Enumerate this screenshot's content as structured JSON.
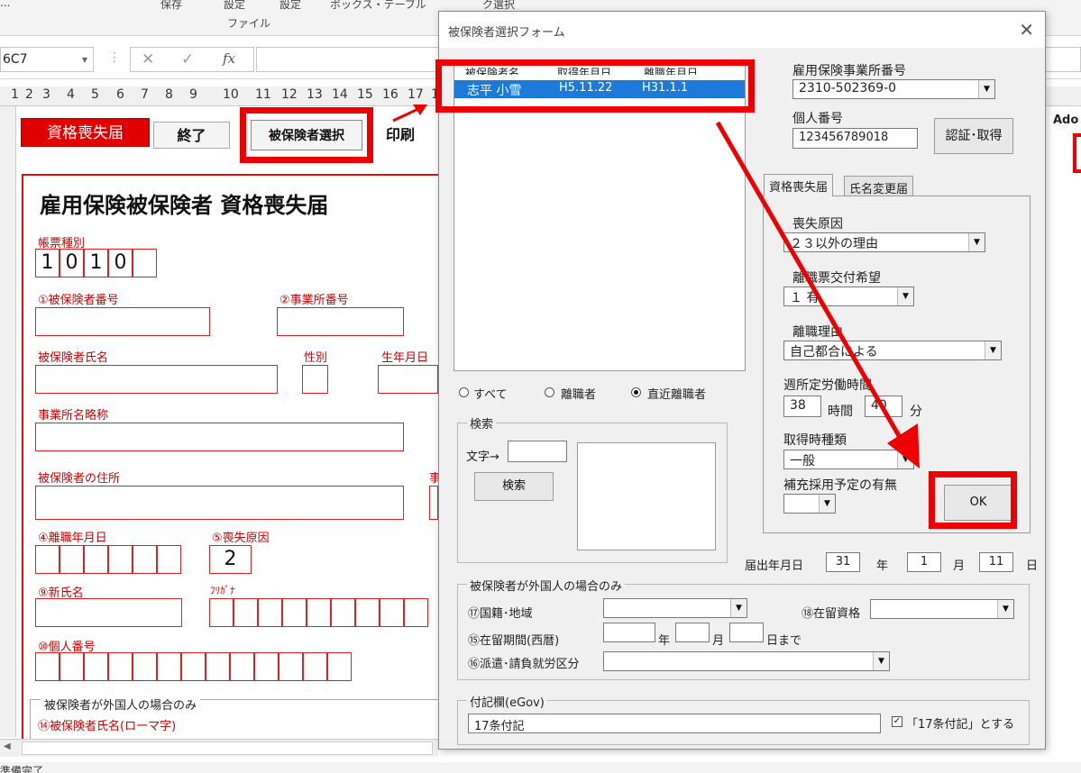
{
  "ribbon": {
    "frags": [
      "...",
      "保存",
      "設定",
      "設定",
      "ボックス・テーブル",
      "...",
      "ク選択",
      "...",
      "...",
      "..."
    ],
    "group_label": "ファイル"
  },
  "formula_bar": {
    "namebox": "6C7",
    "cancel_glyph": "✕",
    "enter_glyph": "✓",
    "fx_glyph": "fx"
  },
  "columns": [
    "1",
    "2",
    "3",
    "4",
    "5",
    "6",
    "7",
    "8",
    "9",
    "10",
    "11",
    "12",
    "13",
    "14",
    "15",
    "16",
    "17",
    "1"
  ],
  "sheet": {
    "form_title_button": "資格喪失届",
    "exit_button": "終了",
    "select_insured_button": "被保険者選択",
    "print_button": "印刷",
    "title": "雇用保険被保険者 資格喪失届",
    "form_type_label": "帳票種別",
    "form_type_digits": [
      "1",
      "0",
      "1",
      "0",
      ""
    ],
    "insured_number_label": "①被保険者番号",
    "office_number_label": "②事業所番号",
    "insured_name_label": "被保険者氏名",
    "gender_label": "性別",
    "birthdate_label": "生年月日",
    "office_name_label": "事業所名略称",
    "insured_address_label": "被保険者の住所",
    "address_side_fragment": "事",
    "separation_date_label": "④離職年月日",
    "loss_reason_label": "⑤喪失原因",
    "loss_reason_value": "2",
    "new_name_label": "⑨新氏名",
    "furigana_label": "ﾌﾘｶﾞﾅ",
    "my_number_label": "⑩個人番号",
    "foreign_group_label": "被保険者が外国人の場合のみ",
    "romaji_name_label": "⑭被保険者氏名(ローマ字)"
  },
  "side_text": "Ado",
  "status_text": "準備完了",
  "dialog": {
    "title": "被保険者選択フォーム",
    "close_glyph": "✕",
    "list": {
      "headers": [
        "被保険者名",
        "取得年月日",
        "離職年月日"
      ],
      "rows": [
        {
          "name": "志平 小雪",
          "acquired": "H5.11.22",
          "separated": "H31.1.1"
        }
      ]
    },
    "filter": {
      "all": "すべて",
      "separated": "離職者",
      "recent": "直近離職者",
      "selected": "recent"
    },
    "search": {
      "group_label": "検索",
      "text_label": "文字→",
      "text_value": "",
      "button": "検索"
    },
    "office_number_label": "雇用保険事業所番号",
    "office_number_value": "2310-502369-0",
    "my_number_label": "個人番号",
    "my_number_value": "123456789018",
    "auth_button": "認証･取得",
    "tabs": [
      "資格喪失届",
      "氏名変更届"
    ],
    "loss_tab": {
      "loss_reason_label": "喪失原因",
      "loss_reason_value": "２３以外の理由",
      "separation_slip_label": "離職票交付希望",
      "separation_slip_value": "１ 有",
      "separation_reason_label": "離職理由",
      "separation_reason_value": "自己都合による",
      "weekly_hours_label": "週所定労働時間",
      "hours_value": "38",
      "hours_unit": "時間",
      "minutes_value": "40",
      "minutes_unit": "分",
      "acq_type_label": "取得時種類",
      "acq_type_value": "一般",
      "replacement_label": "補充採用予定の有無",
      "replacement_value": "",
      "ok_button": "OK"
    },
    "filing_date": {
      "label": "届出年月日",
      "year": "31",
      "year_unit": "年",
      "month": "1",
      "month_unit": "月",
      "day": "11",
      "day_unit": "日"
    },
    "foreign": {
      "group_label": "被保険者が外国人の場合のみ",
      "nationality_label": "⑰国籍･地域",
      "nationality_value": "",
      "residence_status_label": "⑱在留資格",
      "residence_status_value": "",
      "residence_period_label": "⑮在留期間(西暦)",
      "year_unit": "年",
      "month_unit": "月",
      "until_label": "日まで",
      "dispatch_label": "⑯派遣･請負就労区分",
      "dispatch_value": ""
    },
    "notes": {
      "group_label": "付記欄(eGov)",
      "value": "17条付記",
      "checkbox_label": "「17条付記」とする",
      "checkbox_checked": true
    }
  },
  "colors": {
    "highlight": "#ee0000",
    "selection": "#1e7ad8",
    "dialog_bg": "#f0f0f0"
  }
}
